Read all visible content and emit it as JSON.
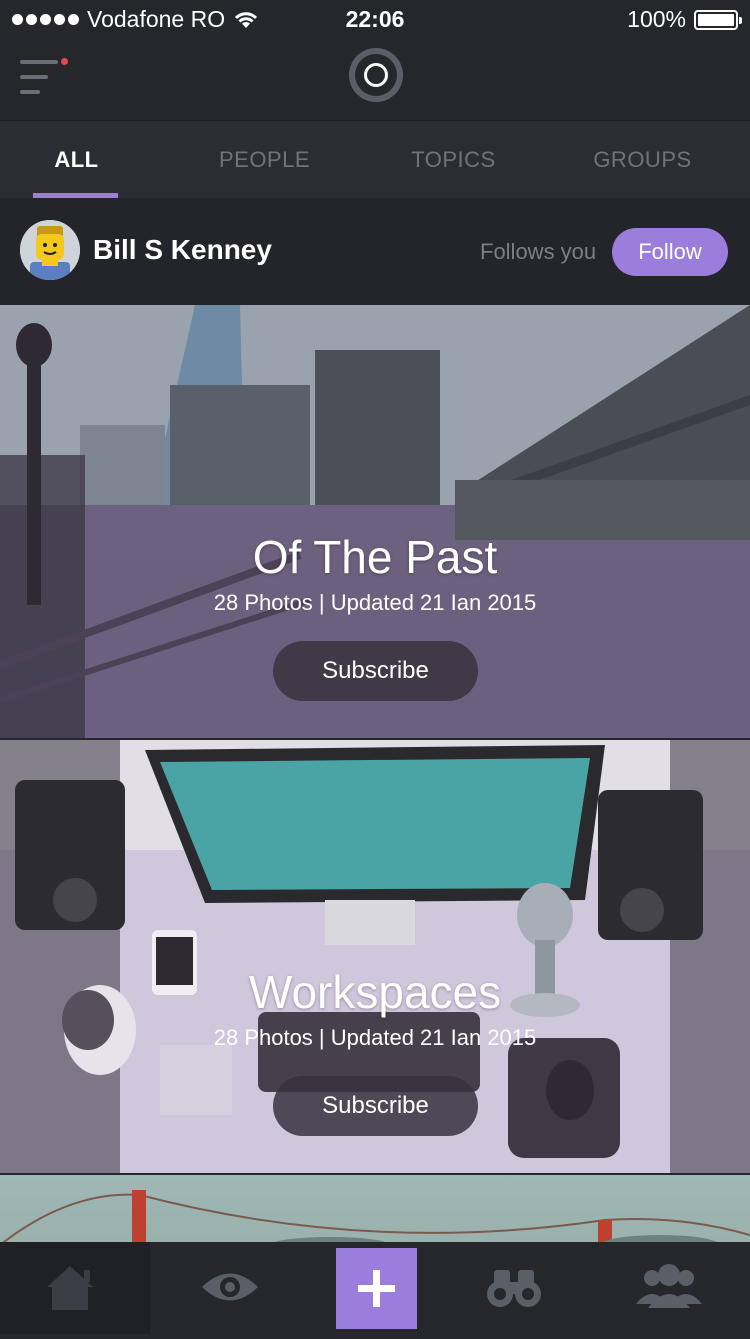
{
  "status_bar": {
    "carrier": "Vodafone RO",
    "time": "22:06",
    "battery": "100%"
  },
  "top_nav": {
    "menu_icon": "menu-icon",
    "logo_icon": "ring-logo-icon",
    "notification_dot_color": "#e5484d"
  },
  "tabs": [
    {
      "label": "ALL",
      "active": true
    },
    {
      "label": "PEOPLE",
      "active": false
    },
    {
      "label": "TOPICS",
      "active": false
    },
    {
      "label": "GROUPS",
      "active": false
    }
  ],
  "profile": {
    "name": "Bill S Kenney",
    "status": "Follows you",
    "follow_label": "Follow"
  },
  "albums": [
    {
      "title": "Of The Past",
      "meta": "28 Photos | Updated 21 Ian 2015",
      "button": "Subscribe"
    },
    {
      "title": "Workspaces",
      "meta": "28 Photos | Updated 21 Ian 2015",
      "button": "Subscribe"
    }
  ],
  "bottom_bar": {
    "items": [
      "home-icon",
      "eye-icon",
      "plus-icon",
      "binoculars-icon",
      "group-icon"
    ]
  },
  "colors": {
    "accent": "#9b7edb",
    "background": "#26282d"
  }
}
